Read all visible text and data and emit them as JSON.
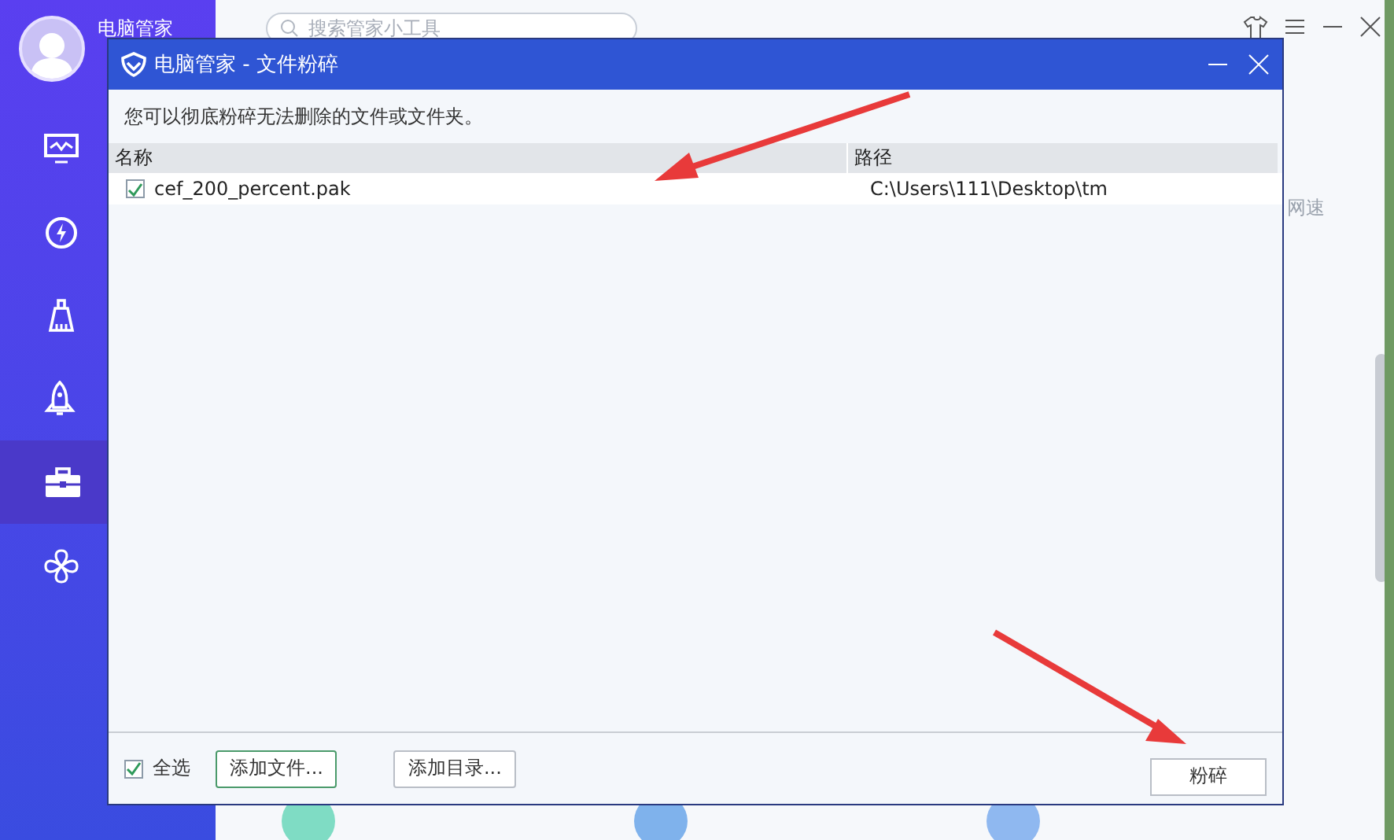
{
  "app": {
    "user_name": "电脑管家",
    "nav": [
      {
        "selected": false
      },
      {
        "selected": false
      },
      {
        "selected": false
      },
      {
        "selected": false
      },
      {
        "selected": true
      },
      {
        "selected": false
      }
    ],
    "search": {
      "placeholder": "搜索管家小工具"
    },
    "side_label": "网速"
  },
  "dialog": {
    "title": "电脑管家 - 文件粉碎",
    "description": "您可以彻底粉碎无法删除的文件或文件夹。",
    "columns": [
      "名称",
      "路径"
    ],
    "rows": [
      {
        "name": "cef_200_percent.pak",
        "path": "C:\\Users\\111\\Desktop\\tm",
        "checked": true
      }
    ],
    "select_all": {
      "label": "全选",
      "checked": true
    },
    "buttons": [
      {
        "label": "添加文件...",
        "kind": "primary"
      },
      {
        "label": "添加目录...",
        "kind": "secondary"
      }
    ],
    "shred_button": "粉碎"
  }
}
